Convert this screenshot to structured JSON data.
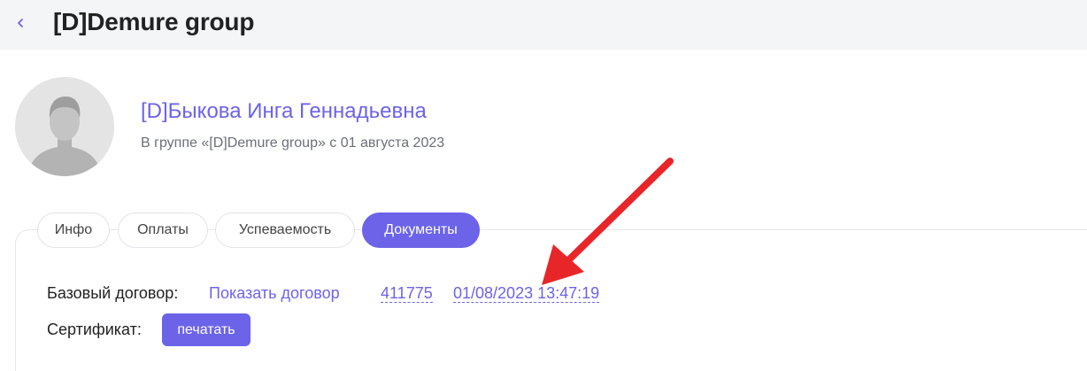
{
  "header": {
    "title": "[D]Demure group",
    "back_icon": "chevron-left-icon"
  },
  "profile": {
    "name": "[D]Быкова Инга Геннадьевна",
    "subtitle": "В группе «[D]Demure group» с 01 августа 2023",
    "avatar_icon": "user-avatar-placeholder"
  },
  "tabs": [
    {
      "label": "Инфо",
      "active": false
    },
    {
      "label": "Оплаты",
      "active": false
    },
    {
      "label": "Успеваемость",
      "active": false
    },
    {
      "label": "Документы",
      "active": true
    }
  ],
  "documents": {
    "contract_label": "Базовый договор:",
    "contract_link": "Показать договор",
    "contract_number": "411775",
    "contract_datetime": "01/08/2023 13:47:19",
    "certificate_label": "Сертификат:",
    "print_button": "печатать"
  },
  "colors": {
    "accent": "#6c63e9",
    "annotation_arrow": "#e8262a",
    "topbar_bg": "#f4f5f7"
  }
}
